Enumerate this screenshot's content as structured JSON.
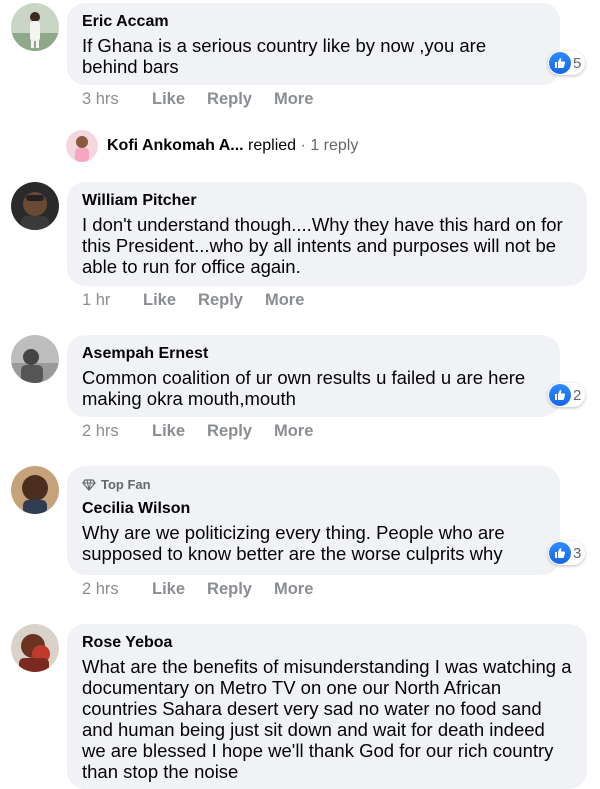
{
  "comments": [
    {
      "author": "Eric Accam",
      "text": "If Ghana is a serious country like by now ,you are behind bars",
      "time": "3 hrs",
      "reactions": "5"
    },
    {
      "author": "William Pitcher",
      "text": "I don't understand though....Why they have this hard on for this President...who by all intents and purposes will not be able to run for office again.",
      "time": "1 hr"
    },
    {
      "author": "Asempah Ernest",
      "text": "Common coalition of ur own results u failed u are here making okra mouth,mouth",
      "time": "2 hrs",
      "reactions": "2"
    },
    {
      "badge": "Top Fan",
      "author": "Cecilia Wilson",
      "text": "Why are we politicizing every thing. People who are supposed to know better are the worse culprits why",
      "time": "2 hrs",
      "reactions": "3"
    },
    {
      "author": "Rose Yeboa",
      "text": "What are the benefits of misunderstanding I was watching a documentary on Metro TV on one our North African countries Sahara desert very sad no water no food sand and human being just sit down and wait for death indeed we are blessed I hope we'll thank God for our rich country than stop the noise"
    }
  ],
  "reply_summary": {
    "author": "Kofi Ankomah A...",
    "verb": "replied",
    "separator": "·",
    "count": "1 reply"
  },
  "actions": {
    "like": "Like",
    "reply": "Reply",
    "more": "More"
  },
  "colors": {
    "bubble": "#f0f2f5",
    "meta": "#8a8d91",
    "like_blue": "#1877f2"
  },
  "icons": [
    "like-icon",
    "diamond-icon",
    "avatar"
  ]
}
